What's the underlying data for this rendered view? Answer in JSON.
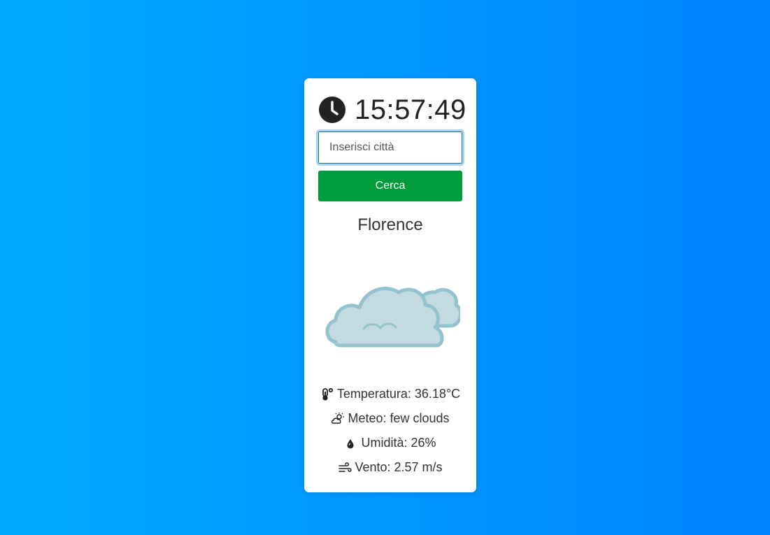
{
  "clock": {
    "time": "15:57:49",
    "icon": "clock-icon"
  },
  "search": {
    "placeholder": "Inserisci città",
    "value": "",
    "button_label": "Cerca"
  },
  "weather": {
    "city": "Florence",
    "icon": "few-clouds-icon",
    "details": [
      {
        "icon": "thermometer-icon",
        "text": "Temperatura: 36.18°C"
      },
      {
        "icon": "partly-cloudy-icon",
        "text": "Meteo: few clouds"
      },
      {
        "icon": "droplet-icon",
        "text": "Umidità: 26%"
      },
      {
        "icon": "wind-icon",
        "text": "Vento: 2.57 m/s"
      }
    ]
  },
  "colors": {
    "background_start": "#00aaff",
    "background_end": "#0083ff",
    "button": "#009c3b",
    "cloud_fill": "#c2dae0",
    "cloud_stroke": "#94c3d0"
  }
}
